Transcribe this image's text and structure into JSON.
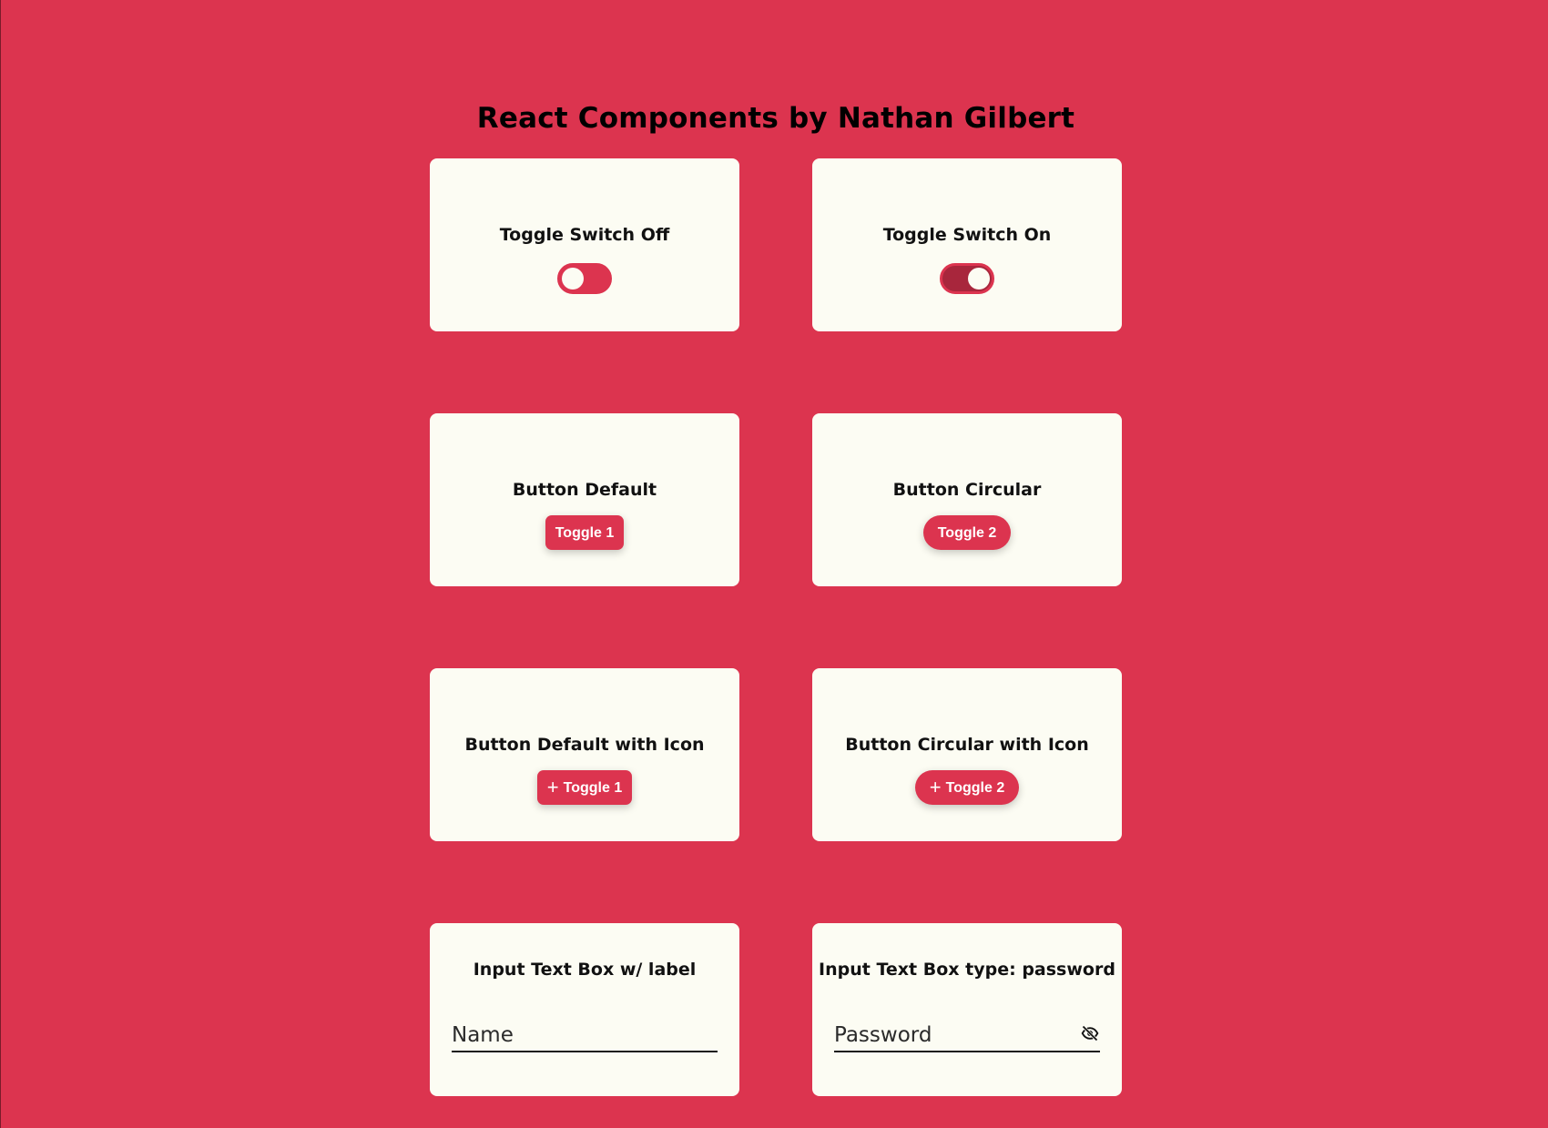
{
  "page": {
    "title": "React Components by Nathan Gilbert"
  },
  "colors": {
    "background": "#dc344f",
    "card": "#fcfcf3",
    "accent": "#dc344f",
    "accent_dark": "#a8263c"
  },
  "cards": {
    "toggle_off": {
      "title": "Toggle Switch Off",
      "state": "off"
    },
    "toggle_on": {
      "title": "Toggle Switch On",
      "state": "on"
    },
    "button_default": {
      "title": "Button Default",
      "button_label": "Toggle 1"
    },
    "button_circular": {
      "title": "Button Circular",
      "button_label": "Toggle 2"
    },
    "button_default_icon": {
      "title": "Button Default with Icon",
      "button_label": "Toggle 1",
      "icon": "plus-icon"
    },
    "button_circular_icon": {
      "title": "Button Circular with Icon",
      "button_label": "Toggle 2",
      "icon": "plus-icon"
    },
    "input_label": {
      "title": "Input Text Box w/ label",
      "placeholder": "Name",
      "value": ""
    },
    "input_password": {
      "title": "Input Text Box type: password",
      "placeholder": "Password",
      "value": "",
      "icon": "eye-off-icon"
    }
  }
}
